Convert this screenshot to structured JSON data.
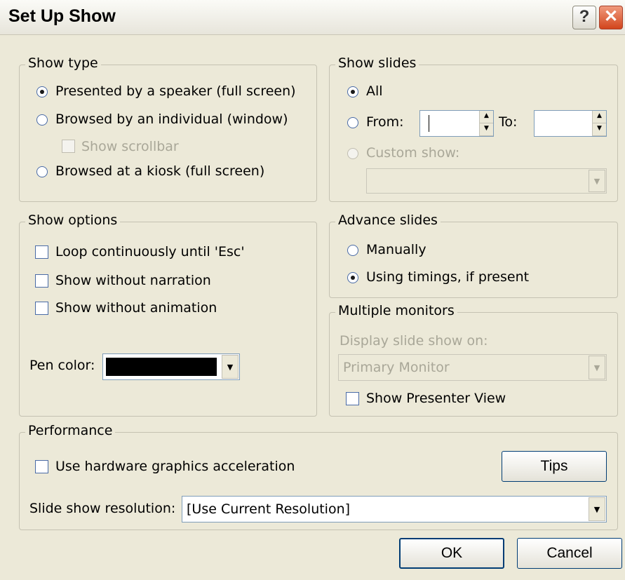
{
  "window": {
    "title": "Set Up Show",
    "help_glyph": "?",
    "close_glyph": "✕"
  },
  "show_type": {
    "legend": "Show type",
    "speaker": "Presented by a speaker (full screen)",
    "individual": "Browsed by an individual (window)",
    "scrollbar": "Show scrollbar",
    "kiosk": "Browsed at a kiosk (full screen)",
    "selected": "speaker"
  },
  "show_slides": {
    "legend": "Show slides",
    "all": "All",
    "from": "From:",
    "from_value": "",
    "to": "To:",
    "to_value": "",
    "custom": "Custom show:",
    "custom_value": "",
    "selected": "all"
  },
  "show_options": {
    "legend": "Show options",
    "loop": "Loop continuously until 'Esc'",
    "no_narration": "Show without narration",
    "no_animation": "Show without animation",
    "pen_color_label": "Pen color:",
    "pen_color_value": "#000000"
  },
  "advance_slides": {
    "legend": "Advance slides",
    "manually": "Manually",
    "timings": "Using timings, if present",
    "selected": "timings"
  },
  "multiple_monitors": {
    "legend": "Multiple monitors",
    "display_label": "Display slide show on:",
    "display_value": "Primary Monitor",
    "presenter_view": "Show Presenter View"
  },
  "performance": {
    "legend": "Performance",
    "hw_accel": "Use hardware graphics acceleration",
    "tips": "Tips",
    "resolution_label": "Slide show resolution:",
    "resolution_value": "[Use Current Resolution]"
  },
  "footer": {
    "ok": "OK",
    "cancel": "Cancel"
  },
  "icons": {
    "dropdown": "▼",
    "spin_up": "▲",
    "spin_down": "▼"
  }
}
